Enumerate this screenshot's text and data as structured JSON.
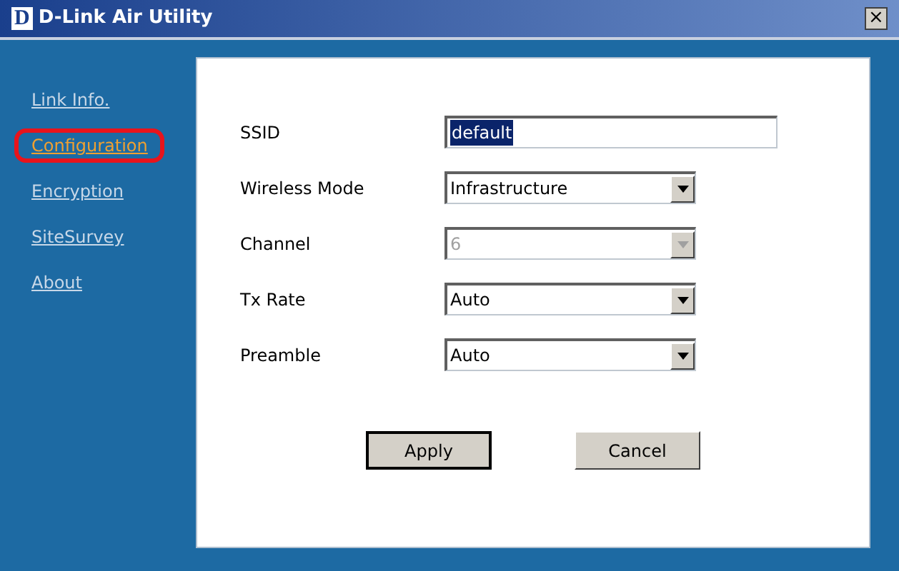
{
  "window": {
    "logo": "D",
    "title": "D-Link Air Utility",
    "close": "×"
  },
  "sidebar": {
    "items": [
      {
        "label": "Link Info.",
        "selected": false,
        "highlighted": false
      },
      {
        "label": "Configuration",
        "selected": true,
        "highlighted": true
      },
      {
        "label": "Encryption",
        "selected": false,
        "highlighted": false
      },
      {
        "label": "SiteSurvey",
        "selected": false,
        "highlighted": false
      },
      {
        "label": "About",
        "selected": false,
        "highlighted": false
      }
    ]
  },
  "fields": [
    {
      "label": "SSID",
      "kind": "text",
      "value": "default",
      "disabled": false
    },
    {
      "label": "Wireless Mode",
      "kind": "dropdown",
      "value": "Infrastructure",
      "disabled": false
    },
    {
      "label": "Channel",
      "kind": "dropdown",
      "value": "6",
      "disabled": true
    },
    {
      "label": "Tx Rate",
      "kind": "dropdown",
      "value": "Auto",
      "disabled": false
    },
    {
      "label": "Preamble",
      "kind": "dropdown",
      "value": "Auto",
      "disabled": false
    }
  ],
  "buttons": [
    {
      "label": "Apply",
      "default": true
    },
    {
      "label": "Cancel",
      "default": false
    }
  ]
}
